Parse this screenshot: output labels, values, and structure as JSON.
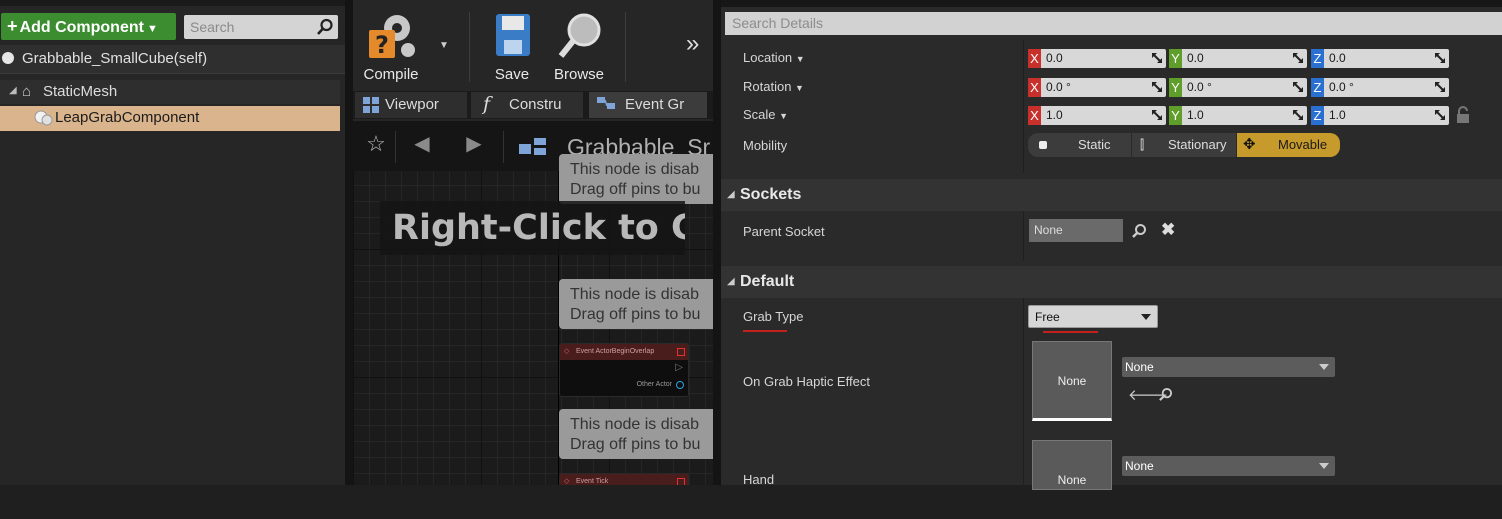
{
  "components_panel": {
    "add_component_label": "Add Component",
    "search_placeholder": "Search",
    "self_item": "Grabbable_SmallCube(self)",
    "tree": [
      {
        "label": "StaticMesh"
      },
      {
        "label": "LeapGrabComponent"
      }
    ]
  },
  "toolbar": {
    "compile": "Compile",
    "save": "Save",
    "browse": "Browse"
  },
  "editor_tabs": [
    "Viewpor",
    "Constru",
    "Event Gr"
  ],
  "graph": {
    "title": "Grabbable_Sr",
    "hint": "Right-Click to Cre",
    "comment_line1": "This node is disab",
    "comment_line2": "Drag off pins to bu",
    "node1_title": "Event ActorBeginOverlap",
    "node1_pin": "Other Actor",
    "node2_title": "Event Tick"
  },
  "details": {
    "search_placeholder": "Search Details",
    "location_label": "Location",
    "rotation_label": "Rotation",
    "scale_label": "Scale",
    "location": {
      "x": "0.0",
      "y": "0.0",
      "z": "0.0"
    },
    "rotation": {
      "x": "0.0 °",
      "y": "0.0 °",
      "z": "0.0 °"
    },
    "scale": {
      "x": "1.0",
      "y": "1.0",
      "z": "1.0"
    },
    "axis": {
      "x": "X",
      "y": "Y",
      "z": "Z"
    },
    "mobility_label": "Mobility",
    "mobility_options": {
      "static": "Static",
      "stationary": "Stationary",
      "movable": "Movable"
    },
    "sockets_header": "Sockets",
    "parent_socket_label": "Parent Socket",
    "parent_socket_value": "None",
    "default_header": "Default",
    "grab_type_label": "Grab Type",
    "grab_type_value": "Free",
    "haptic_label": "On Grab Haptic Effect",
    "haptic_thumb": "None",
    "haptic_value": "None",
    "hand_label": "Hand",
    "hand_thumb": "None",
    "hand_value": "None"
  },
  "colors": {
    "add_green": "#3b8d2f",
    "selected_row": "#d9b48c",
    "axis_x": "#c8312b",
    "axis_y": "#5f9e2a",
    "axis_z": "#2a70d0",
    "movable_active": "#c79b2b"
  }
}
